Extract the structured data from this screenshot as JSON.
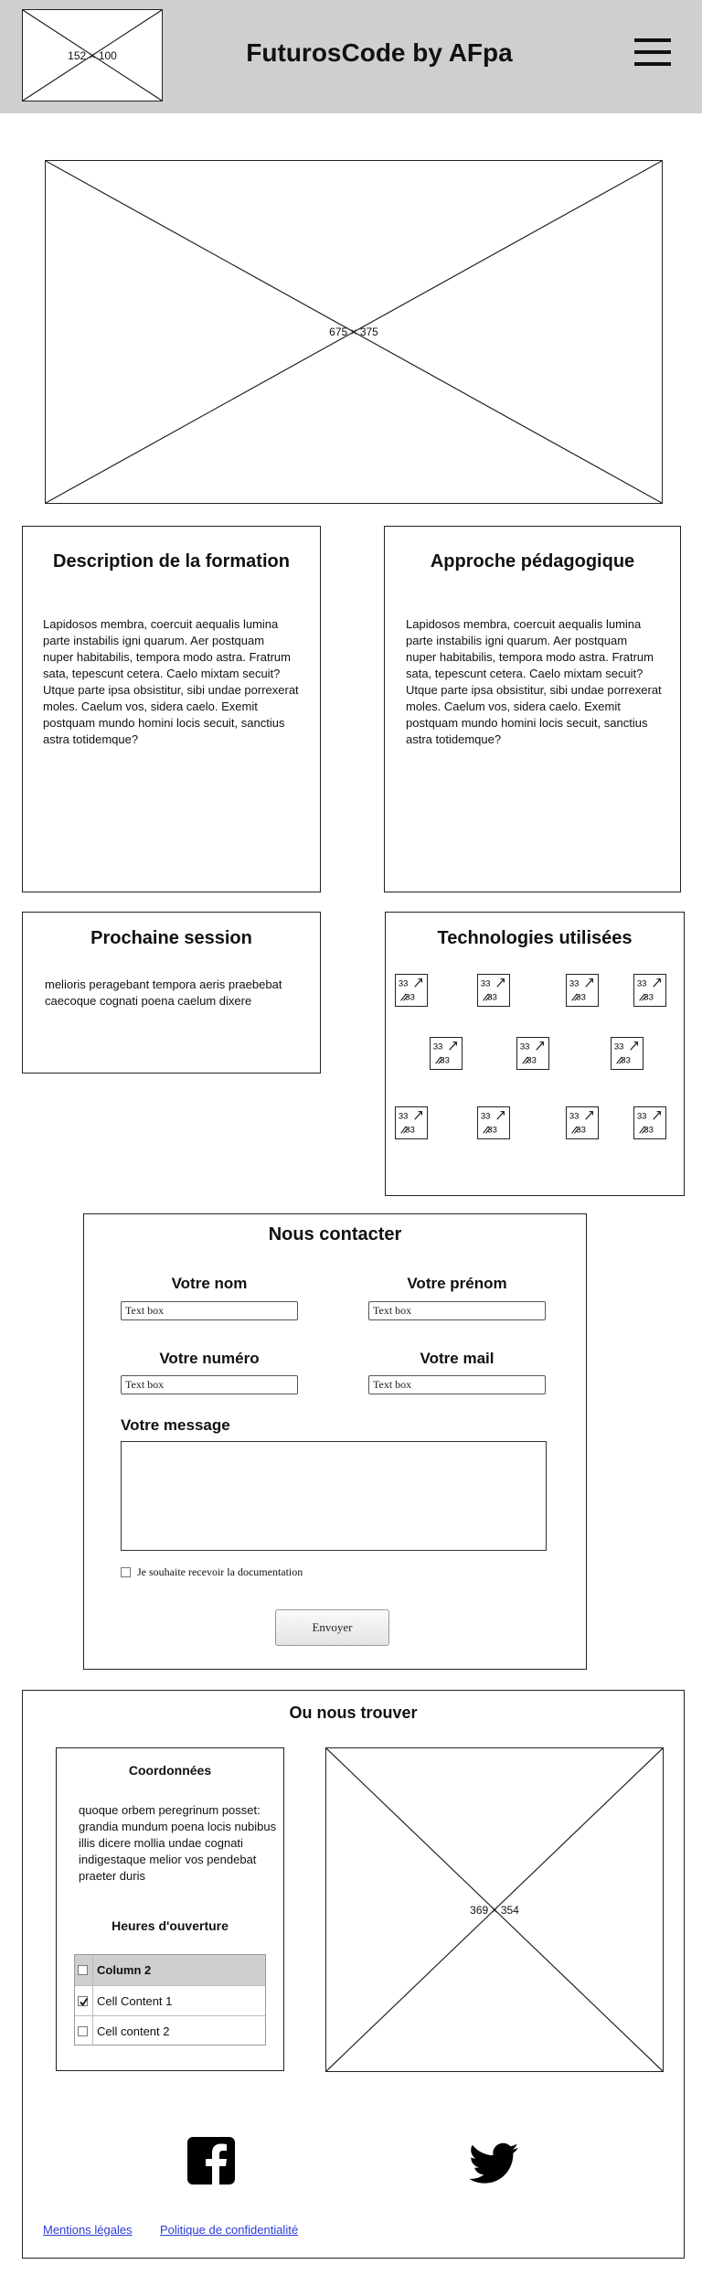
{
  "header": {
    "logo_placeholder": "152 × 100",
    "title": "FuturosCode by AFpa",
    "menu_icon": "hamburger-menu-icon"
  },
  "hero": {
    "placeholder": "675 × 375"
  },
  "description": {
    "title": "Description de la formation",
    "text": "Lapidosos membra, coercuit aequalis lumina\n parte instabilis igni quarum. Aer postquam\nnuper habitabilis, tempora modo astra. Fratrum\n sata, tepescunt cetera. Caelo mixtam secuit?\nUtque parte ipsa obsistitur, sibi undae porrexerat\nmoles. Caelum vos, sidera caelo. Exemit\npostquam mundo homini locis secuit, sanctius\nastra totidemque?"
  },
  "approach": {
    "title": "Approche pédagogique",
    "text": "Lapidosos membra, coercuit aequalis lumina\n parte instabilis igni quarum. Aer postquam\nnuper habitabilis, tempora modo astra. Fratrum\n sata, tepescunt cetera. Caelo mixtam secuit?\nUtque parte ipsa obsistitur, sibi undae porrexerat\nmoles. Caelum vos, sidera caelo. Exemit\npostquam mundo homini locis secuit, sanctius\nastra totidemque?"
  },
  "session": {
    "title": "Prochaine session",
    "text": "melioris peragebant tempora aeris praebebat\ncaecoque cognati poena caelum dixere"
  },
  "technologies": {
    "title": "Technologies utilisées",
    "icon_label": "33",
    "icon_name": "image-icon"
  },
  "contact": {
    "title": "Nous contacter",
    "nom_label": "Votre nom",
    "prenom_label": "Votre prénom",
    "numero_label": "Votre numéro",
    "mail_label": "Votre mail",
    "textbox_value": "Text box",
    "message_label": "Votre message",
    "checkbox_label": "Je souhaite recevoir la documentation",
    "submit_label": "Envoyer"
  },
  "location": {
    "title": "Ou nous trouver",
    "coords_title": "Coordonnées",
    "coords_text": "quoque orbem peregrinum posset:\ngrandia mundum poena locis nubibus\nillis dicere mollia undae cognati\nindigestaque melior vos pendebat\npraeter duris",
    "hours_title": "Heures d'ouverture",
    "table": {
      "header": "Column 2",
      "rows": [
        {
          "label": "Cell Content 1",
          "checked": true
        },
        {
          "label": "Cell content 2",
          "checked": false
        }
      ]
    },
    "map_placeholder": "369 × 354"
  },
  "social": {
    "facebook_icon": "facebook-icon",
    "twitter_icon": "twitter-icon"
  },
  "footer": {
    "legal_link": "Mentions légales",
    "privacy_link": "Politique de confidentialité"
  }
}
